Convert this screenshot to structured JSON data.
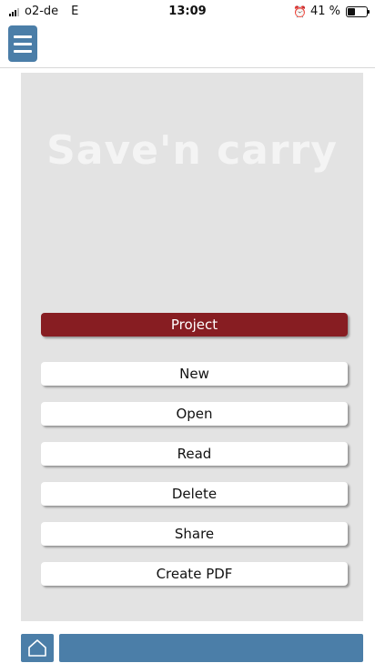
{
  "status_bar": {
    "carrier": "o2-de",
    "network": "E",
    "time": "13:09",
    "battery": "41 %",
    "battery_level": 0.41
  },
  "header": {
    "menu_icon": "hamburger-menu-icon"
  },
  "main": {
    "title": "Save'n carry",
    "section_label": "Project",
    "buttons": [
      {
        "label": "New"
      },
      {
        "label": "Open"
      },
      {
        "label": "Read"
      },
      {
        "label": "Delete"
      },
      {
        "label": "Share"
      },
      {
        "label": "Create PDF"
      }
    ]
  },
  "footer": {
    "home_icon": "home-icon"
  },
  "colors": {
    "accent_blue": "#4b7ea8",
    "project_red": "#871d22",
    "panel_gray": "#e3e3e3"
  }
}
